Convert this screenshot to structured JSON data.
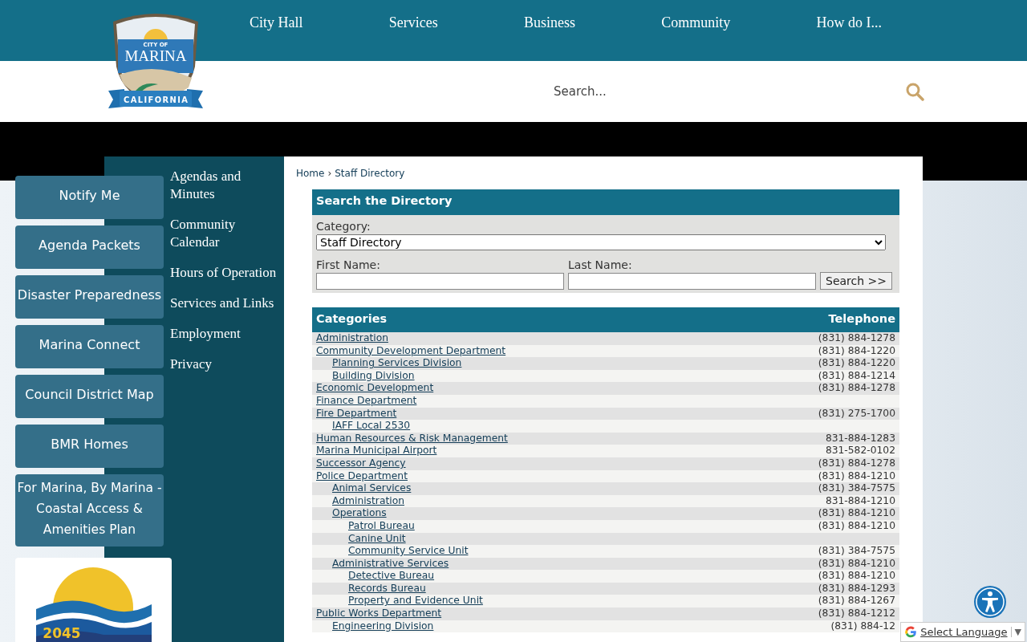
{
  "logo": {
    "top": "CITY OF",
    "name": "MARINA",
    "ribbon": "CALIFORNIA"
  },
  "nav": [
    {
      "label": "City Hall"
    },
    {
      "label": "Services"
    },
    {
      "label": "Business"
    },
    {
      "label": "Community"
    },
    {
      "label": "How do I..."
    }
  ],
  "search": {
    "placeholder": "Search..."
  },
  "sidebar": {
    "items": [
      {
        "label": "Agendas and Minutes"
      },
      {
        "label": "Community Calendar"
      },
      {
        "label": "Hours of Operation"
      },
      {
        "label": "Services and Links"
      },
      {
        "label": "Employment"
      },
      {
        "label": "Privacy"
      }
    ]
  },
  "quick_links": [
    {
      "label": "Notify Me"
    },
    {
      "label": "Agenda Packets"
    },
    {
      "label": "Disaster Preparedness"
    },
    {
      "label": "Marina Connect"
    },
    {
      "label": "Council District Map"
    },
    {
      "label": "BMR Homes"
    },
    {
      "label": "For Marina, By Marina - Coastal Access & Amenities Plan"
    }
  ],
  "promo_logo": {
    "text": "2045"
  },
  "breadcrumb": [
    {
      "label": "Home"
    },
    {
      "label": "Staff Directory"
    }
  ],
  "breadcrumb_separator": "›",
  "directory_search": {
    "title": "Search the Directory",
    "category_label": "Category:",
    "category_value": "Staff Directory",
    "first_name_label": "First Name:",
    "last_name_label": "Last Name:",
    "button": "Search >>"
  },
  "table": {
    "columns": [
      "Categories",
      "Telephone"
    ],
    "rows": [
      {
        "name": "Administration",
        "phone": "(831) 884-1278"
      },
      {
        "name": "Community Development Department",
        "phone": "(831) 884-1220",
        "children": [
          {
            "name": "Planning Services Division",
            "phone": "(831) 884-1220"
          },
          {
            "name": "Building Division",
            "phone": "(831) 884-1214"
          }
        ]
      },
      {
        "name": "Economic Development",
        "phone": "(831) 884-1278"
      },
      {
        "name": "Finance Department"
      },
      {
        "name": "Fire Department",
        "phone": "(831) 275-1700",
        "children": [
          {
            "name": "IAFF Local 2530"
          }
        ]
      },
      {
        "name": "Human Resources & Risk Management",
        "phone": "831-884-1283"
      },
      {
        "name": "Marina Municipal Airport",
        "phone": "831-582-0102"
      },
      {
        "name": "Successor Agency",
        "phone": "(831) 884-1278"
      },
      {
        "name": "Police Department",
        "phone": "(831) 884-1210",
        "children": [
          {
            "name": "Animal Services",
            "phone": "(831) 384-7575"
          },
          {
            "name": "Administration",
            "phone": "831-884-1210"
          },
          {
            "name": "Operations",
            "phone": "(831) 884-1210",
            "children": [
              {
                "name": "Patrol Bureau",
                "phone": "(831) 884-1210"
              },
              {
                "name": "Canine Unit"
              },
              {
                "name": "Community Service Unit",
                "phone": "(831) 384-7575"
              }
            ]
          },
          {
            "name": "Administrative Services",
            "phone": "(831) 884-1210",
            "children": [
              {
                "name": "Detective Bureau",
                "phone": "(831) 884-1210"
              },
              {
                "name": "Records Bureau",
                "phone": "(831) 884-1293"
              },
              {
                "name": "Property and Evidence Unit",
                "phone": "(831) 884-1267"
              }
            ]
          }
        ]
      },
      {
        "name": "Public Works Department",
        "phone": "(831) 884-1212",
        "children": [
          {
            "name": "Engineering Division",
            "phone": "(831) 884-12"
          }
        ]
      }
    ]
  },
  "translate": {
    "label": "Select Language",
    "caret": "▼"
  }
}
